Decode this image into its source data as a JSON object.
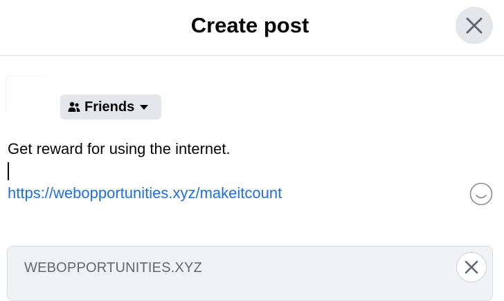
{
  "dialog": {
    "title": "Create post"
  },
  "composer": {
    "audience_label": "Friends",
    "text_line": "Get reward for using the internet.",
    "link": "https://webopportunities.xyz/makeitcount"
  },
  "link_preview": {
    "domain": "WEBOPPORTUNITIES.XYZ"
  },
  "icons": {
    "close": "close-icon",
    "audience": "friends-icon",
    "caret": "caret-down-icon",
    "emoji": "emoji-icon",
    "preview_close": "close-icon"
  },
  "colors": {
    "link": "#216fdb",
    "button_bg": "#e4e6eb",
    "text": "#050505",
    "muted": "#65676b"
  }
}
